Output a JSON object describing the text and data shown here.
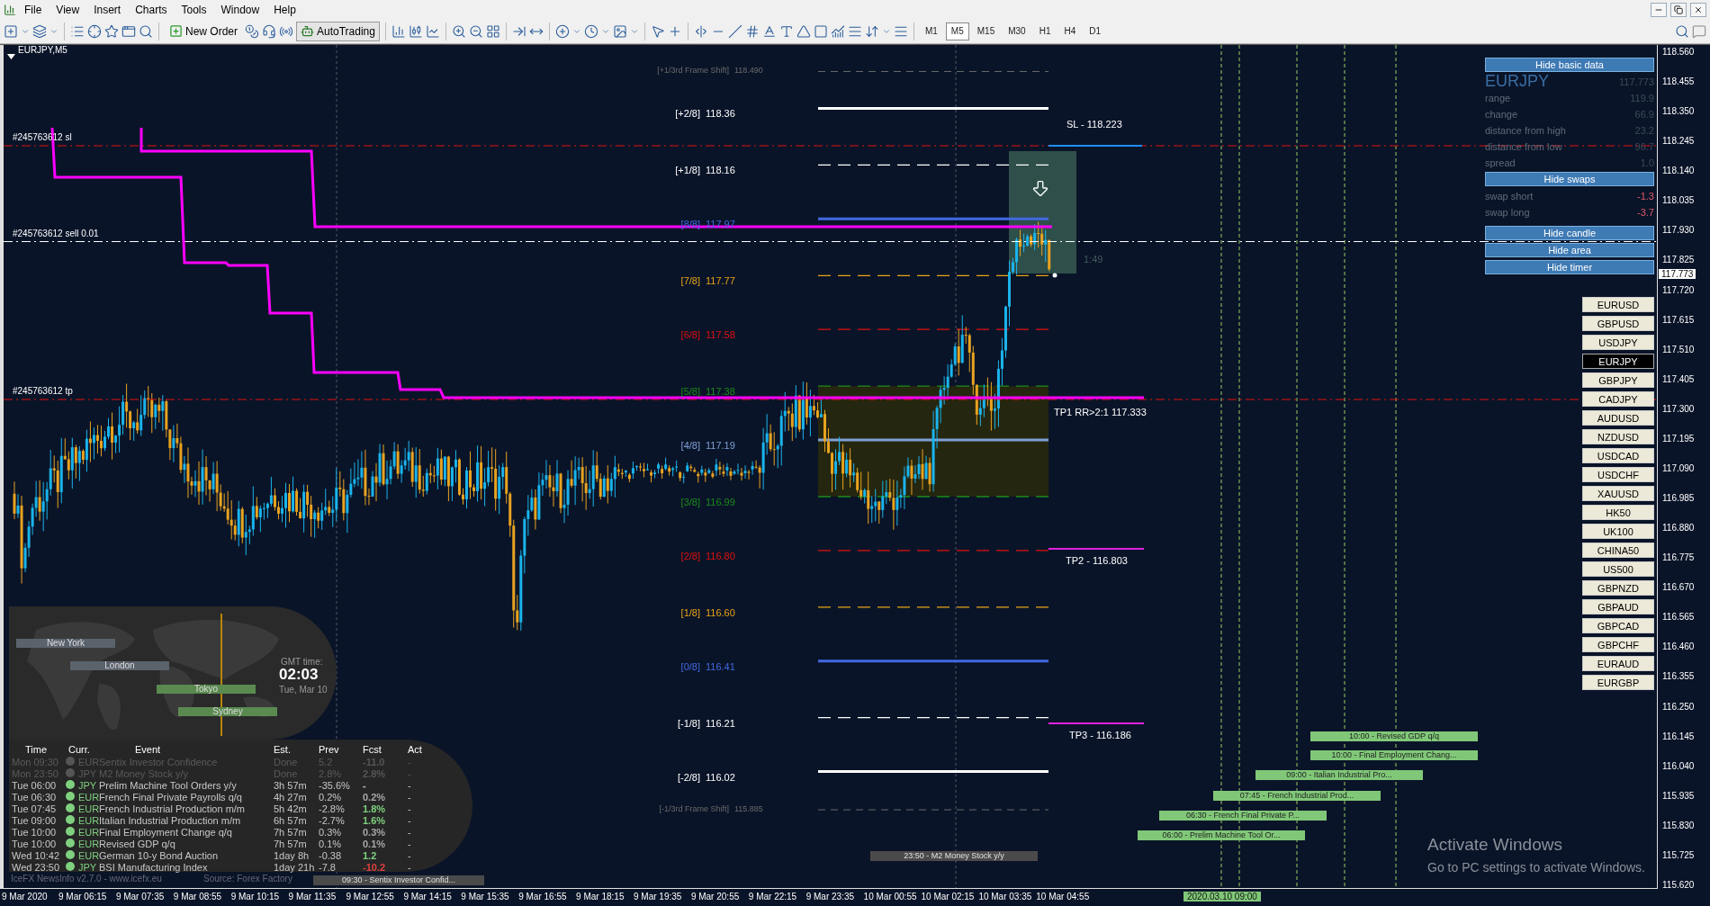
{
  "menu": [
    "File",
    "View",
    "Insert",
    "Charts",
    "Tools",
    "Window",
    "Help"
  ],
  "toolbar": {
    "new_order": "New Order",
    "auto_trading": "AutoTrading",
    "timeframes": [
      {
        "label": "M1",
        "selected": false
      },
      {
        "label": "M5",
        "selected": true
      },
      {
        "label": "M15",
        "selected": false
      },
      {
        "label": "M30",
        "selected": false
      },
      {
        "label": "H1",
        "selected": false
      },
      {
        "label": "H4",
        "selected": false
      },
      {
        "label": "D1",
        "selected": false
      }
    ]
  },
  "chart": {
    "title": "EURJPY,M5",
    "order_labels": [
      "#245763612 sl",
      "#245763612 sell 0.01",
      "#245763612 tp"
    ],
    "levels": [
      {
        "tag": "[+1/3rd Frame Shift]",
        "value": "118.490",
        "color": "#6a6a6a",
        "kind": "frame"
      },
      {
        "tag": "[+2/8]",
        "value": "118.36",
        "color": "#ffffff",
        "kind": "solid"
      },
      {
        "tag": "[+1/8]",
        "value": "118.16",
        "color": "#ffffff",
        "kind": "dashed"
      },
      {
        "tag": "[8/8]",
        "value": "117.97",
        "color": "#4169e1",
        "kind": "solid"
      },
      {
        "tag": "[7/8]",
        "value": "117.77",
        "color": "#e8a317",
        "kind": "dashed"
      },
      {
        "tag": "[6/8]",
        "value": "117.58",
        "color": "#e01010",
        "kind": "dashed"
      },
      {
        "tag": "[5/8]",
        "value": "117.38",
        "color": "#1a8c1a",
        "kind": "dashed"
      },
      {
        "tag": "[4/8]",
        "value": "117.19",
        "color": "#7fa0d8",
        "kind": "solid"
      },
      {
        "tag": "[3/8]",
        "value": "116.99",
        "color": "#1a8c1a",
        "kind": "dashed"
      },
      {
        "tag": "[2/8]",
        "value": "116.80",
        "color": "#e01010",
        "kind": "dashed"
      },
      {
        "tag": "[1/8]",
        "value": "116.60",
        "color": "#e8a317",
        "kind": "dashed"
      },
      {
        "tag": "[0/8]",
        "value": "116.41",
        "color": "#4169e1",
        "kind": "solid"
      },
      {
        "tag": "[-1/8]",
        "value": "116.21",
        "color": "#ffffff",
        "kind": "dashed"
      },
      {
        "tag": "[-2/8]",
        "value": "116.02",
        "color": "#ffffff",
        "kind": "solid"
      },
      {
        "tag": "[-1/3rd Frame Shift]",
        "value": "115.885",
        "color": "#6a6a6a",
        "kind": "frame"
      }
    ],
    "targets": [
      "SL - 118.223",
      "TP1 RR>2:1 117.333",
      "TP2 - 116.803",
      "TP3 - 116.186"
    ],
    "ratio": "1:49",
    "news_bars": [
      {
        "text": "10:00 - Revised GDP q/q",
        "past": false
      },
      {
        "text": "10:00 - Final Employment Chang...",
        "past": false
      },
      {
        "text": "09:00 - Italian Industrial Pro...",
        "past": false
      },
      {
        "text": "07:45 - French Industrial Prod...",
        "past": false
      },
      {
        "text": "06:30 - French Final Private P...",
        "past": false
      },
      {
        "text": "06:00 - Prelim Machine Tool Or...",
        "past": false
      },
      {
        "text": "23:50 - M2 Money Stock y/y",
        "past": true
      }
    ],
    "watermark": [
      "Activate Windows",
      "Go to PC settings to activate Windows."
    ]
  },
  "info_panel": {
    "hide_basic": "Hide basic data",
    "symbol": "EURJPY",
    "price": "117.773",
    "rows": [
      {
        "label": "range",
        "value": "119.9"
      },
      {
        "label": "change",
        "value": "66.9"
      },
      {
        "label": "distance from high",
        "value": "23.2"
      },
      {
        "label": "distance from low",
        "value": "96.7"
      },
      {
        "label": "spread",
        "value": "1.0"
      }
    ],
    "hide_swaps": "Hide swaps",
    "swaps": [
      {
        "label": "swap short",
        "value": "-1.3"
      },
      {
        "label": "swap long",
        "value": "-3.7"
      }
    ],
    "buttons": [
      "Hide candle",
      "Hide area",
      "Hide timer"
    ]
  },
  "symbols": [
    {
      "label": "EURUSD",
      "selected": false
    },
    {
      "label": "GBPUSD",
      "selected": false
    },
    {
      "label": "USDJPY",
      "selected": false
    },
    {
      "label": "EURJPY",
      "selected": true
    },
    {
      "label": "GBPJPY",
      "selected": false
    },
    {
      "label": "CADJPY",
      "selected": false
    },
    {
      "label": "AUDUSD",
      "selected": false
    },
    {
      "label": "NZDUSD",
      "selected": false
    },
    {
      "label": "USDCAD",
      "selected": false
    },
    {
      "label": "USDCHF",
      "selected": false
    },
    {
      "label": "XAUUSD",
      "selected": false
    },
    {
      "label": "HK50",
      "selected": false
    },
    {
      "label": "UK100",
      "selected": false
    },
    {
      "label": "CHINA50",
      "selected": false
    },
    {
      "label": "US500",
      "selected": false
    },
    {
      "label": "GBPNZD",
      "selected": false
    },
    {
      "label": "GBPAUD",
      "selected": false
    },
    {
      "label": "GBPCAD",
      "selected": false
    },
    {
      "label": "GBPCHF",
      "selected": false
    },
    {
      "label": "EURAUD",
      "selected": false
    },
    {
      "label": "EURGBP",
      "selected": false
    }
  ],
  "sessions": {
    "markets": [
      {
        "name": "New York",
        "active": false
      },
      {
        "name": "London",
        "active": false
      },
      {
        "name": "Tokyo",
        "active": true
      },
      {
        "name": "Sydney",
        "active": true
      }
    ],
    "gmt_label": "GMT time:",
    "gmt_time": "02:03",
    "gmt_date": "Tue, Mar 10"
  },
  "news": {
    "columns": [
      "Time",
      "Curr.",
      "Event",
      "Est.",
      "Prev",
      "Fcst",
      "Act"
    ],
    "rows": [
      {
        "time": "Mon 09:30",
        "currency": "EUR",
        "event": "Sentix Investor Confidence",
        "est": "Done",
        "prev": "5.2",
        "fcst": "-11.0",
        "act": "-",
        "done": true,
        "color": "#555555"
      },
      {
        "time": "Mon 23:50",
        "currency": "JPY",
        "event": "M2 Money Stock y/y",
        "est": "Done",
        "prev": "2.8%",
        "fcst": "2.8%",
        "act": "-",
        "done": true,
        "color": "#555555"
      },
      {
        "time": "Tue 06:00",
        "currency": "JPY",
        "event": "Prelim Machine Tool Orders y/y",
        "est": "3h 57m",
        "prev": "-35.6%",
        "fcst": "-",
        "act": "-",
        "done": false
      },
      {
        "time": "Tue 06:30",
        "currency": "EUR",
        "event": "French Final Private Payrolls q/q",
        "est": "4h 27m",
        "prev": "0.2%",
        "fcst": "0.2%",
        "act": "-",
        "done": false,
        "color": "#a8a8a8"
      },
      {
        "time": "Tue 07:45",
        "currency": "EUR",
        "event": "French Industrial Production m/m",
        "est": "5h 42m",
        "prev": "-2.8%",
        "fcst": "1.8%",
        "act": "-",
        "done": false,
        "color": "#7fd07f"
      },
      {
        "time": "Tue 09:00",
        "currency": "EUR",
        "event": "Italian Industrial Production m/m",
        "est": "6h 57m",
        "prev": "-2.7%",
        "fcst": "1.6%",
        "act": "-",
        "done": false,
        "color": "#7fd07f"
      },
      {
        "time": "Tue 10:00",
        "currency": "EUR",
        "event": "Final Employment Change q/q",
        "est": "7h 57m",
        "prev": "0.3%",
        "fcst": "0.3%",
        "act": "-",
        "done": false,
        "color": "#a8a8a8"
      },
      {
        "time": "Tue 10:00",
        "currency": "EUR",
        "event": "Revised GDP q/q",
        "est": "7h 57m",
        "prev": "0.1%",
        "fcst": "0.1%",
        "act": "-",
        "done": false,
        "color": "#a8a8a8"
      },
      {
        "time": "Wed 10:42",
        "currency": "EUR",
        "event": "German 10-y Bond Auction",
        "est": "1day 8h",
        "prev": "-0.38",
        "fcst": "1.2",
        "act": "-",
        "done": false,
        "color": "#7fd07f"
      },
      {
        "time": "Wed 23:50",
        "currency": "JPY",
        "event": "BSI Manufacturing Index",
        "est": "1day 21h",
        "prev": "-7.8",
        "fcst": "-10.2",
        "act": "-",
        "done": false,
        "color": "#e04040"
      }
    ],
    "footer": "IceFX NewsInfo v2.7.0  -  www.icefx.eu",
    "source": "Source: Forex Factory",
    "ticker": "09:30 - Sentix Investor Confid..."
  },
  "price_axis": {
    "labels": [
      "118.560",
      "118.455",
      "118.350",
      "118.245",
      "118.140",
      "118.035",
      "117.930",
      "117.825",
      "117.720",
      "117.615",
      "117.510",
      "117.405",
      "117.300",
      "117.195",
      "117.090",
      "116.985",
      "116.880",
      "116.775",
      "116.670",
      "116.565",
      "116.460",
      "116.355",
      "116.250",
      "116.145",
      "116.040",
      "115.935",
      "115.830",
      "115.725",
      "115.620"
    ],
    "current": "117.773"
  },
  "time_axis": {
    "labels": [
      "9 Mar 2020",
      "9 Mar 06:15",
      "9 Mar 07:35",
      "9 Mar 08:55",
      "9 Mar 10:15",
      "9 Mar 11:35",
      "9 Mar 12:55",
      "9 Mar 14:15",
      "9 Mar 15:35",
      "9 Mar 16:55",
      "9 Mar 18:15",
      "9 Mar 19:35",
      "9 Mar 20:55",
      "9 Mar 22:15",
      "9 Mar 23:35",
      "10 Mar 00:55",
      "10 Mar 02:15",
      "10 Mar 03:35",
      "10 Mar 04:55"
    ],
    "marker": "2020.03.10 09:00"
  }
}
